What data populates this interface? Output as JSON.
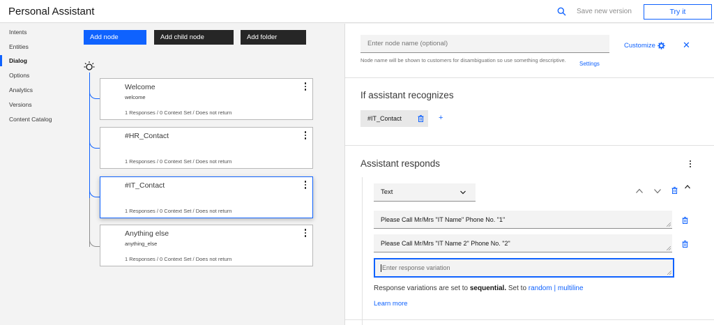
{
  "header": {
    "app_title": "Personal Assistant",
    "save_version": "Save new version",
    "try_it": "Try it"
  },
  "sidenav": {
    "items": [
      {
        "label": "Intents"
      },
      {
        "label": "Entities"
      },
      {
        "label": "Dialog",
        "active": true
      },
      {
        "label": "Options"
      },
      {
        "label": "Analytics"
      },
      {
        "label": "Versions"
      },
      {
        "label": "Content Catalog"
      }
    ]
  },
  "toolbar": {
    "add_node": "Add node",
    "add_child_node": "Add child node",
    "add_folder": "Add folder"
  },
  "nodes": [
    {
      "title": "Welcome",
      "condition": "welcome",
      "meta": "1 Responses / 0 Context Set / Does not return"
    },
    {
      "title": "#HR_Contact",
      "condition": "",
      "meta": "1 Responses / 0 Context Set / Does not return"
    },
    {
      "title": "#IT_Contact",
      "condition": "",
      "meta": "1 Responses / 0 Context Set / Does not return",
      "selected": true
    },
    {
      "title": "Anything else",
      "condition": "anything_else",
      "meta": "1 Responses / 0 Context Set / Does not return"
    }
  ],
  "editor": {
    "node_name_placeholder": "Enter node name (optional)",
    "helper_text": "Node name will be shown to customers for disambiguation so use something descriptive.",
    "settings": "Settings",
    "customize": "Customize",
    "recognizes_title": "If assistant recognizes",
    "condition_tag": "#IT_Contact",
    "add_condition": "+",
    "responds_title": "Assistant responds",
    "response_type": "Text",
    "variations": [
      "Please Call Mr/Mrs \"IT Name\" Phone No. \"1\"",
      "Please Call Mr/Mrs \"IT Name 2\" Phone No. \"2\""
    ],
    "variation_placeholder": "Enter response variation",
    "sequential_prefix": "Response variations are set to ",
    "sequential_word": "sequential.",
    "set_to": " Set to ",
    "random": "random",
    "separator": " | ",
    "multiline": "multiline",
    "learn_more": "Learn more"
  },
  "colors": {
    "accent": "#0f62fe",
    "dark_button": "#262626"
  }
}
